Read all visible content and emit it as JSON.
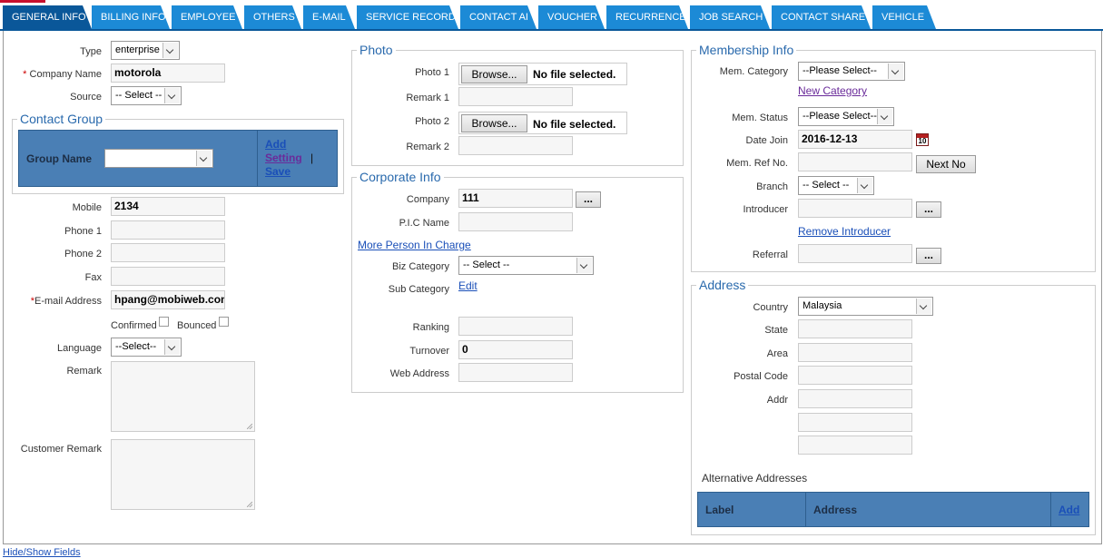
{
  "tabs": [
    {
      "label": "GENERAL INFO",
      "active": true
    },
    {
      "label": "BILLING INFO"
    },
    {
      "label": "EMPLOYEE"
    },
    {
      "label": "OTHERS"
    },
    {
      "label": "E-MAIL"
    },
    {
      "label": "SERVICE RECORD"
    },
    {
      "label": "CONTACT AI"
    },
    {
      "label": "VOUCHER"
    },
    {
      "label": "RECURRENCE"
    },
    {
      "label": "JOB SEARCH"
    },
    {
      "label": "CONTACT SHARE"
    },
    {
      "label": "VEHICLE"
    }
  ],
  "general": {
    "type_label": "Type",
    "type_value": "enterprise",
    "company_label": "Company Name",
    "company_value": "motorola",
    "source_label": "Source",
    "source_value": "-- Select --",
    "mobile_label": "Mobile",
    "mobile_value": "2134",
    "phone1_label": "Phone 1",
    "phone2_label": "Phone 2",
    "fax_label": "Fax",
    "email_label": "E-mail Address",
    "email_value": "hpang@mobiweb.com",
    "confirmed_label": "Confirmed",
    "bounced_label": "Bounced",
    "language_label": "Language",
    "language_value": "--Select--",
    "remark_label": "Remark",
    "customer_remark_label": "Customer Remark",
    "required_mark": "*"
  },
  "contact_group": {
    "legend": "Contact Group",
    "group_name_label": "Group Name",
    "add_label": "Add",
    "setting_label": "Setting",
    "separator": "|",
    "save_label": "Save"
  },
  "photo": {
    "legend": "Photo",
    "photo1_label": "Photo 1",
    "remark1_label": "Remark 1",
    "photo2_label": "Photo 2",
    "remark2_label": "Remark 2",
    "browse_label": "Browse...",
    "no_file_text": "No file selected."
  },
  "corporate": {
    "legend": "Corporate Info",
    "company_label": "Company",
    "company_value": "111",
    "pic_label": "P.I.C Name",
    "more_pic_link": "More Person In Charge",
    "biz_category_label": "Biz Category",
    "biz_category_value": "-- Select --",
    "sub_category_label": "Sub Category",
    "edit_link": "Edit",
    "ranking_label": "Ranking",
    "turnover_label": "Turnover",
    "turnover_value": "0",
    "web_label": "Web Address",
    "ellipsis": "..."
  },
  "membership": {
    "legend": "Membership Info",
    "category_label": "Mem. Category",
    "category_value": "--Please Select--",
    "new_category_link": "New Category",
    "status_label": "Mem. Status",
    "status_value": "--Please Select--",
    "date_join_label": "Date Join",
    "date_join_value": "2016-12-13",
    "calendar_day": "10",
    "ref_no_label": "Mem. Ref No.",
    "next_no_label": "Next No",
    "branch_label": "Branch",
    "branch_value": "-- Select --",
    "introducer_label": "Introducer",
    "remove_introducer_link": "Remove Introducer",
    "referral_label": "Referral",
    "ellipsis": "..."
  },
  "address": {
    "legend": "Address",
    "country_label": "Country",
    "country_value": "Malaysia",
    "state_label": "State",
    "area_label": "Area",
    "postal_label": "Postal Code",
    "addr_label": "Addr",
    "alt_addresses_label": "Alternative Addresses",
    "table_label_col": "Label",
    "table_address_col": "Address",
    "table_add_link": "Add"
  },
  "footer": {
    "hide_show_link": "Hide/Show Fields"
  }
}
